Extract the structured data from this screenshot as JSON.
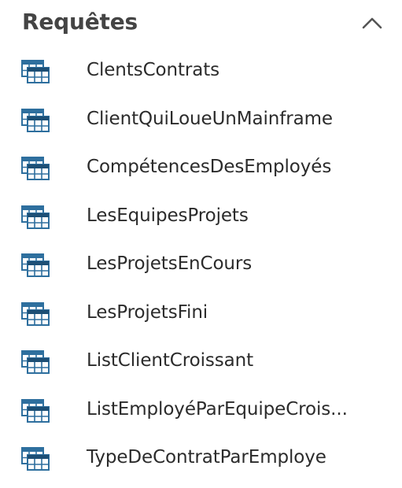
{
  "navigation_pane": {
    "group": {
      "title": "Requêtes",
      "collapse_icon": "chevron-up-icon",
      "items": [
        {
          "label": "ClentsContrats",
          "icon": "query-icon"
        },
        {
          "label": "ClientQuiLoueUnMainframe",
          "icon": "query-icon"
        },
        {
          "label": "CompétencesDesEmployés",
          "icon": "query-icon"
        },
        {
          "label": "LesEquipesProjets",
          "icon": "query-icon"
        },
        {
          "label": "LesProjetsEnCours",
          "icon": "query-icon"
        },
        {
          "label": "LesProjetsFini",
          "icon": "query-icon"
        },
        {
          "label": "ListClientCroissant",
          "icon": "query-icon"
        },
        {
          "label": "ListEmployéParEquipeCrois...",
          "icon": "query-icon"
        },
        {
          "label": "TypeDeContratParEmploye",
          "icon": "query-icon"
        }
      ]
    }
  },
  "colors": {
    "icon_grid": "#2e6f9e",
    "icon_header": "#1d4f75",
    "icon_overlay_bg": "#ffffff",
    "text": "#2b2b2b",
    "header_text": "#444444"
  }
}
